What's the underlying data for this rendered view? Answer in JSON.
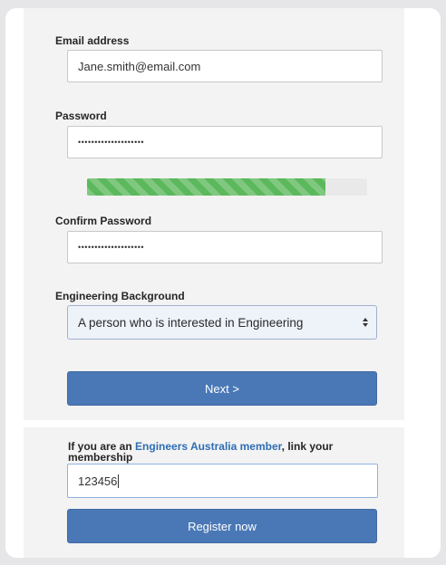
{
  "form": {
    "email_label": "Email address",
    "email_value": "Jane.smith@email.com",
    "password_label": "Password",
    "password_value": "••••••••••••••••••••",
    "password_strength": 0.85,
    "confirm_label": "Confirm Password",
    "confirm_value": "••••••••••••••••••••",
    "background_label": "Engineering Background",
    "background_selected": "A person who is interested in Engineering",
    "next_label": "Next >"
  },
  "membership": {
    "prompt_prefix": "If you are an ",
    "prompt_link": "Engineers Australia member",
    "prompt_suffix": ", link your membership",
    "member_value": "123456",
    "register_label": "Register now"
  },
  "colors": {
    "accent": "#4a78b6",
    "link": "#2f6db5",
    "strength": "#5cb85c"
  }
}
